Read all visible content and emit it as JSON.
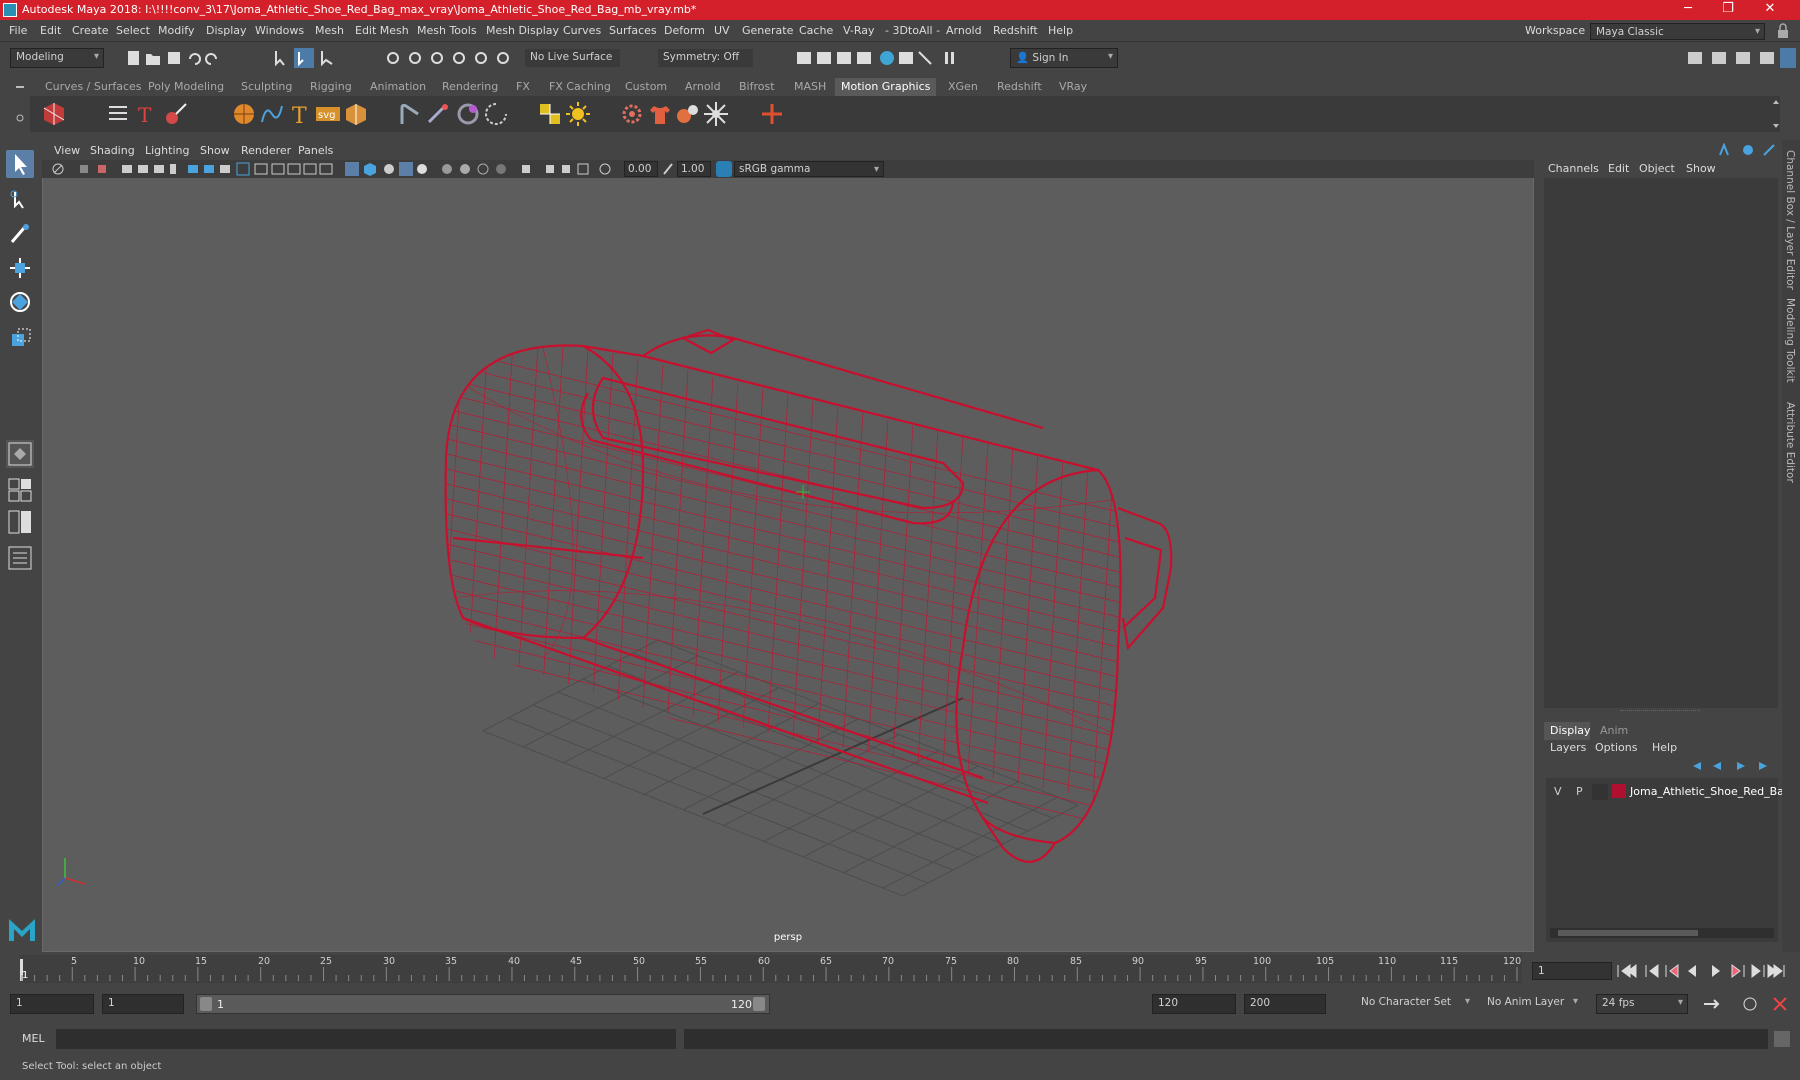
{
  "window": {
    "title": "Autodesk Maya 2018: I:\\!!!!conv_3\\17\\Joma_Athletic_Shoe_Red_Bag_max_vray\\Joma_Athletic_Shoe_Red_Bag_mb_vray.mb*",
    "minimize": "─",
    "restore": "❐",
    "close": "✕"
  },
  "menubar": {
    "items": [
      "File",
      "Edit",
      "Create",
      "Select",
      "Modify",
      "Display",
      "Windows",
      "Mesh",
      "Edit Mesh",
      "Mesh Tools",
      "Mesh Display",
      "Curves",
      "Surfaces",
      "Deform",
      "UV",
      "Generate",
      "Cache",
      "V-Ray",
      "- 3DtoAll -",
      "Arnold",
      "Redshift",
      "Help"
    ],
    "workspace_label": "Workspace :",
    "workspace_value": "Maya Classic"
  },
  "statusline": {
    "mode": "Modeling",
    "live_surface": "No Live Surface",
    "symmetry": "Symmetry: Off",
    "sign_in": "Sign In"
  },
  "shelf": {
    "tabs": [
      "Curves / Surfaces",
      "Poly Modeling",
      "Sculpting",
      "Rigging",
      "Animation",
      "Rendering",
      "FX",
      "FX Caching",
      "Custom",
      "Arnold",
      "Bifrost",
      "MASH",
      "Motion Graphics",
      "XGen",
      "Redshift",
      "VRay"
    ],
    "active_tab": "Motion Graphics",
    "icons": [
      "cube-3d-icon",
      "list-icon",
      "text-icon",
      "brush-icon",
      "sphere-icon",
      "curve-icon",
      "text-t-icon",
      "svg-label",
      "box-icon",
      "sweep-icon",
      "sparkle-icon",
      "lathe-icon",
      "swirl-icon",
      "align-icon",
      "sun-icon",
      "gear-icon",
      "shirt-icon",
      "spheres-icon",
      "burst-icon",
      "plus-icon"
    ],
    "svg_label": "svg"
  },
  "viewport": {
    "menus": [
      "View",
      "Shading",
      "Lighting",
      "Show",
      "Renderer",
      "Panels"
    ],
    "exposure": "0.00",
    "gamma": "1.00",
    "colorspace": "sRGB gamma",
    "camera": "persp",
    "wire_color": "#c8102e"
  },
  "channelbox": {
    "menus": [
      "Channels",
      "Edit",
      "Object",
      "Show"
    ]
  },
  "layers": {
    "tabs": [
      "Display",
      "Anim"
    ],
    "active_tab": "Display",
    "menus": [
      "Layers",
      "Options",
      "Help"
    ],
    "rows": [
      {
        "v": "V",
        "p": "P",
        "color": "#b01030",
        "name": "Joma_Athletic_Shoe_Red_Bag"
      }
    ]
  },
  "side_tabs": [
    "Channel Box / Layer Editor",
    "Modeling Toolkit",
    "Attribute Editor"
  ],
  "timeline": {
    "ticks": [
      "5",
      "10",
      "15",
      "20",
      "25",
      "30",
      "35",
      "40",
      "45",
      "50",
      "55",
      "60",
      "65",
      "70",
      "75",
      "80",
      "85",
      "90",
      "95",
      "100",
      "105",
      "110",
      "115",
      "120"
    ],
    "current_frame": "1",
    "current_field": "1"
  },
  "range": {
    "start": "1",
    "start2": "1",
    "slider_start": "1",
    "slider_end": "120",
    "end": "120",
    "end2": "200",
    "character_set": "No Character Set",
    "anim_layer": "No Anim Layer",
    "fps": "24 fps"
  },
  "cmdline": {
    "label": "MEL"
  },
  "help": {
    "text": "Select Tool: select an object"
  }
}
